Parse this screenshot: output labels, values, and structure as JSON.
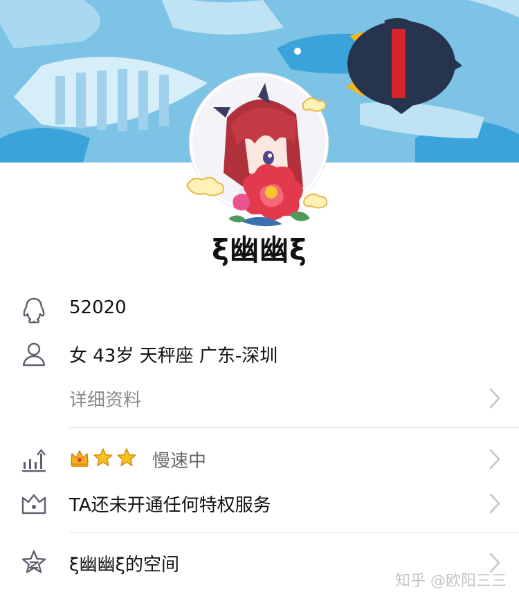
{
  "profile": {
    "nickname": "ξ幽幽ξ",
    "qq_number": "52020",
    "basic_info": "女  43岁  天秤座  广东-深圳",
    "detail_link": "详细资料"
  },
  "level": {
    "status": "慢速中",
    "badges": [
      "crown-icon",
      "star-icon",
      "star-icon"
    ]
  },
  "privilege": {
    "text": "TA还未开通任何特权服务"
  },
  "space": {
    "text": "ξ幽幽ξ的空间"
  },
  "watermark": "知乎 @欧阳三三",
  "colors": {
    "cover_bg": "#7cc3e6",
    "icon_gray": "#5f5f6e",
    "chevron": "#c4c4c4",
    "divider": "#e2e2e2"
  }
}
